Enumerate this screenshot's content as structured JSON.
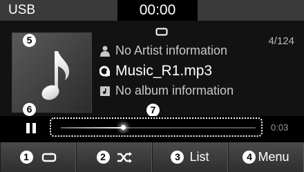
{
  "status_bar": {
    "source": "USB",
    "clock": "00:00"
  },
  "now_playing": {
    "track_count": "4/124",
    "artist": "No Artist information",
    "title": "Music_R1.mp3",
    "album": "No album information",
    "repeat_indicator_icon": "repeat-icon",
    "album_art_icon": "music-note-icon"
  },
  "progress": {
    "elapsed": "0:03",
    "played_fraction": 0.32,
    "play_state_icon": "pause-icon"
  },
  "buttons": [
    {
      "callout": "1",
      "icon": "repeat-icon"
    },
    {
      "callout": "2",
      "icon": "shuffle-icon"
    },
    {
      "callout": "3",
      "label": "List"
    },
    {
      "callout": "4",
      "label": "Menu"
    }
  ],
  "callouts": {
    "album_art": "5",
    "pause": "6",
    "seek_bar": "7"
  },
  "colors": {
    "status_bar": "#3a3a3a",
    "panel": "#121212",
    "button": "#3c3c3c",
    "text_dim": "#c8c8c8"
  }
}
